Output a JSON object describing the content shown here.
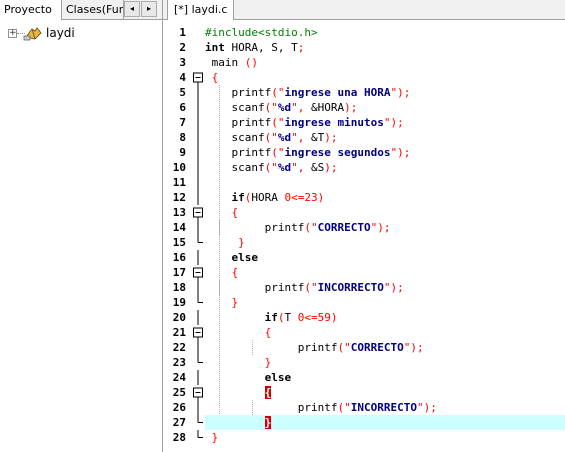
{
  "left_panel": {
    "tabs": [
      {
        "label": "Proyecto",
        "active": true
      },
      {
        "label": "Clases(Fun",
        "active": false
      }
    ],
    "scroll_left_icon": "◂",
    "scroll_right_icon": "▸",
    "tree": {
      "expander": "+",
      "project_name": "laydi"
    }
  },
  "editor": {
    "tab_label": "[*] laydi.c",
    "current_line": 27,
    "highlight_color": "#ccffff",
    "brace_match_color": "#d40000",
    "lines": [
      {
        "n": "1",
        "indent": 0,
        "fold": "",
        "tokens": [
          {
            "t": "#include<stdio.h>",
            "c": "pp"
          }
        ]
      },
      {
        "n": "2",
        "indent": 0,
        "fold": "",
        "tokens": [
          {
            "t": "int",
            "c": "kw"
          },
          {
            "t": " HORA, S, T",
            "c": "t"
          },
          {
            "t": ";",
            "c": "p"
          }
        ]
      },
      {
        "n": "3",
        "indent": 1,
        "fold": "",
        "tokens": [
          {
            "t": "main ",
            "c": "t"
          },
          {
            "t": "()",
            "c": "p"
          }
        ]
      },
      {
        "n": "4",
        "indent": 1,
        "fold": "open",
        "tokens": [
          {
            "t": "{",
            "c": "p"
          }
        ]
      },
      {
        "n": "5",
        "indent": 4,
        "fold": "line",
        "tokens": [
          {
            "t": "printf",
            "c": "t"
          },
          {
            "t": "(",
            "c": "p"
          },
          {
            "t": "\"",
            "c": "q"
          },
          {
            "t": "ingrese una HORA",
            "c": "str"
          },
          {
            "t": "\"",
            "c": "q"
          },
          {
            "t": ");",
            "c": "p"
          }
        ]
      },
      {
        "n": "6",
        "indent": 4,
        "fold": "line",
        "tokens": [
          {
            "t": "scanf",
            "c": "t"
          },
          {
            "t": "(",
            "c": "p"
          },
          {
            "t": "\"",
            "c": "q"
          },
          {
            "t": "%d",
            "c": "str"
          },
          {
            "t": "\"",
            "c": "q"
          },
          {
            "t": ", ",
            "c": "p"
          },
          {
            "t": "&HORA",
            "c": "t"
          },
          {
            "t": ");",
            "c": "p"
          }
        ]
      },
      {
        "n": "7",
        "indent": 4,
        "fold": "line",
        "tokens": [
          {
            "t": "printf",
            "c": "t"
          },
          {
            "t": "(",
            "c": "p"
          },
          {
            "t": "\"",
            "c": "q"
          },
          {
            "t": "ingrese minutos",
            "c": "str"
          },
          {
            "t": "\"",
            "c": "q"
          },
          {
            "t": ");",
            "c": "p"
          }
        ]
      },
      {
        "n": "8",
        "indent": 4,
        "fold": "line",
        "tokens": [
          {
            "t": "scanf",
            "c": "t"
          },
          {
            "t": "(",
            "c": "p"
          },
          {
            "t": "\"",
            "c": "q"
          },
          {
            "t": "%d",
            "c": "str"
          },
          {
            "t": "\"",
            "c": "q"
          },
          {
            "t": ", ",
            "c": "p"
          },
          {
            "t": "&T",
            "c": "t"
          },
          {
            "t": ");",
            "c": "p"
          }
        ]
      },
      {
        "n": "9",
        "indent": 4,
        "fold": "line",
        "tokens": [
          {
            "t": "printf",
            "c": "t"
          },
          {
            "t": "(",
            "c": "p"
          },
          {
            "t": "\"",
            "c": "q"
          },
          {
            "t": "ingrese segundos",
            "c": "str"
          },
          {
            "t": "\"",
            "c": "q"
          },
          {
            "t": ");",
            "c": "p"
          }
        ]
      },
      {
        "n": "10",
        "indent": 4,
        "fold": "line",
        "tokens": [
          {
            "t": "scanf",
            "c": "t"
          },
          {
            "t": "(",
            "c": "p"
          },
          {
            "t": "\"",
            "c": "q"
          },
          {
            "t": "%d",
            "c": "str"
          },
          {
            "t": "\"",
            "c": "q"
          },
          {
            "t": ", ",
            "c": "p"
          },
          {
            "t": "&S",
            "c": "t"
          },
          {
            "t": ");",
            "c": "p"
          }
        ]
      },
      {
        "n": "11",
        "indent": 0,
        "fold": "line",
        "tokens": []
      },
      {
        "n": "12",
        "indent": 4,
        "fold": "line",
        "tokens": [
          {
            "t": "if",
            "c": "kw"
          },
          {
            "t": "(",
            "c": "p"
          },
          {
            "t": "HORA ",
            "c": "t"
          },
          {
            "t": "0",
            "c": "num"
          },
          {
            "t": "<=",
            "c": "p"
          },
          {
            "t": "23",
            "c": "num"
          },
          {
            "t": ")",
            "c": "p"
          }
        ]
      },
      {
        "n": "13",
        "indent": 4,
        "fold": "open",
        "tokens": [
          {
            "t": "{",
            "c": "p"
          }
        ]
      },
      {
        "n": "14",
        "indent": 9,
        "fold": "line",
        "tokens": [
          {
            "t": "printf",
            "c": "t"
          },
          {
            "t": "(",
            "c": "p"
          },
          {
            "t": "\"",
            "c": "q"
          },
          {
            "t": "CORRECTO",
            "c": "str"
          },
          {
            "t": "\"",
            "c": "q"
          },
          {
            "t": ");",
            "c": "p"
          }
        ]
      },
      {
        "n": "15",
        "indent": 5,
        "fold": "end",
        "tokens": [
          {
            "t": "}",
            "c": "p"
          }
        ]
      },
      {
        "n": "16",
        "indent": 4,
        "fold": "line",
        "tokens": [
          {
            "t": "else",
            "c": "kw"
          }
        ]
      },
      {
        "n": "17",
        "indent": 4,
        "fold": "open",
        "tokens": [
          {
            "t": "{",
            "c": "p"
          }
        ]
      },
      {
        "n": "18",
        "indent": 9,
        "fold": "line",
        "tokens": [
          {
            "t": "printf",
            "c": "t"
          },
          {
            "t": "(",
            "c": "p"
          },
          {
            "t": "\"",
            "c": "q"
          },
          {
            "t": "INCORRECTO",
            "c": "str"
          },
          {
            "t": "\"",
            "c": "q"
          },
          {
            "t": ");",
            "c": "p"
          }
        ]
      },
      {
        "n": "19",
        "indent": 4,
        "fold": "end",
        "tokens": [
          {
            "t": "}",
            "c": "p"
          }
        ]
      },
      {
        "n": "20",
        "indent": 9,
        "fold": "line",
        "tokens": [
          {
            "t": "if",
            "c": "kw"
          },
          {
            "t": "(",
            "c": "p"
          },
          {
            "t": "T ",
            "c": "t"
          },
          {
            "t": "0",
            "c": "num"
          },
          {
            "t": "<=",
            "c": "p"
          },
          {
            "t": "59",
            "c": "num"
          },
          {
            "t": ")",
            "c": "p"
          }
        ]
      },
      {
        "n": "21",
        "indent": 9,
        "fold": "open",
        "tokens": [
          {
            "t": "{",
            "c": "p"
          }
        ]
      },
      {
        "n": "22",
        "indent": 14,
        "fold": "line",
        "tokens": [
          {
            "t": "printf",
            "c": "t"
          },
          {
            "t": "(",
            "c": "p"
          },
          {
            "t": "\"",
            "c": "q"
          },
          {
            "t": "CORRECTO",
            "c": "str"
          },
          {
            "t": "\"",
            "c": "q"
          },
          {
            "t": ");",
            "c": "p"
          }
        ]
      },
      {
        "n": "23",
        "indent": 9,
        "fold": "end",
        "tokens": [
          {
            "t": "}",
            "c": "p"
          }
        ]
      },
      {
        "n": "24",
        "indent": 9,
        "fold": "line",
        "tokens": [
          {
            "t": "else",
            "c": "kw"
          }
        ]
      },
      {
        "n": "25",
        "indent": 9,
        "fold": "open",
        "tokens": [
          {
            "t": "{",
            "c": "hl"
          }
        ]
      },
      {
        "n": "26",
        "indent": 14,
        "fold": "line",
        "tokens": [
          {
            "t": "printf",
            "c": "t"
          },
          {
            "t": "(",
            "c": "p"
          },
          {
            "t": "\"",
            "c": "q"
          },
          {
            "t": "INCORRECTO",
            "c": "str"
          },
          {
            "t": "\"",
            "c": "q"
          },
          {
            "t": ");",
            "c": "p"
          }
        ]
      },
      {
        "n": "27",
        "indent": 9,
        "fold": "end",
        "tokens": [
          {
            "t": "}",
            "c": "hl"
          }
        ]
      },
      {
        "n": "28",
        "indent": 1,
        "fold": "end",
        "tokens": [
          {
            "t": "}",
            "c": "p"
          }
        ]
      }
    ]
  }
}
